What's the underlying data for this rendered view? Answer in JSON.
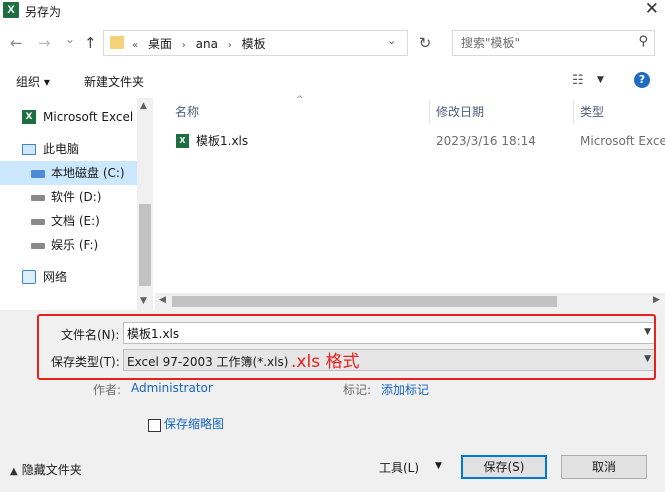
{
  "window": {
    "title": "另存为",
    "app_icon": "excel-icon",
    "close_glyph": "✕"
  },
  "nav": {
    "back": "←",
    "forward": "→",
    "recent": "⌄",
    "up": "↑",
    "breadcrumb": [
      "«",
      "桌面",
      "›",
      "ana",
      "›",
      "模板"
    ],
    "refresh": "↻",
    "search_placeholder": "搜索\"模板\""
  },
  "toolbar": {
    "organize": "组织 ▾",
    "new_folder": "新建文件夹",
    "view_icon": "☷",
    "help": "?"
  },
  "sidebar": {
    "items": [
      {
        "label": "Microsoft Excel",
        "icon": "excel-icon"
      },
      {
        "label": "此电脑",
        "icon": "computer-icon"
      },
      {
        "label": "本地磁盘 (C:)",
        "icon": "drive-icon",
        "selected": true
      },
      {
        "label": "软件 (D:)",
        "icon": "drive-icon"
      },
      {
        "label": "文档 (E:)",
        "icon": "drive-icon"
      },
      {
        "label": "娱乐 (F:)",
        "icon": "drive-icon"
      },
      {
        "label": "网络",
        "icon": "network-icon"
      }
    ]
  },
  "columns": {
    "name": "名称",
    "modified": "修改日期",
    "type": "类型"
  },
  "files": [
    {
      "name": "模板1.xls",
      "modified": "2023/3/16 18:14",
      "type": "Microsoft Exce"
    }
  ],
  "form": {
    "filename_label": "文件名(N):",
    "filename_value": "模板1.xls",
    "filetype_label": "保存类型(T):",
    "filetype_value": "Excel 97-2003 工作簿(*.xls)",
    "annotation": ".xls 格式",
    "author_label": "作者:",
    "author_value": "Administrator",
    "tags_label": "标记:",
    "tags_value": "添加标记",
    "thumbnail_label": "保存缩略图"
  },
  "footer": {
    "hide_folders": "隐藏文件夹",
    "tools": "工具(L)",
    "save": "保存(S)",
    "cancel": "取消"
  },
  "colors": {
    "annotation": "#e8211c",
    "selected": "#cce8ff",
    "link": "#1565c0",
    "accent": "#0078d7"
  }
}
